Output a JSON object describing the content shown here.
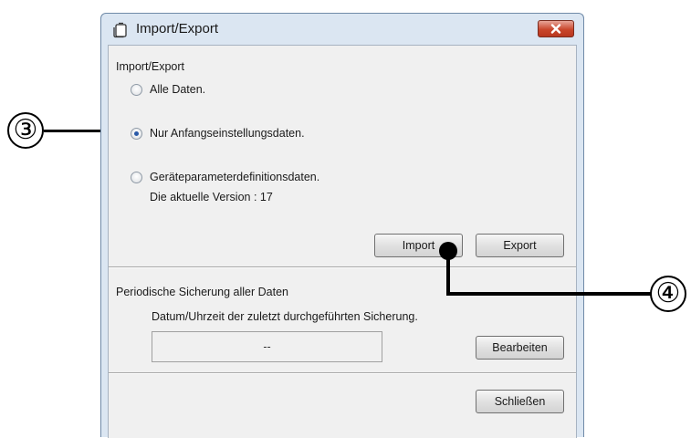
{
  "window": {
    "title": "Import/Export",
    "app_icon": "document-icon",
    "close_icon": "close-icon"
  },
  "import_export": {
    "heading": "Import/Export",
    "options": [
      {
        "label": "Alle Daten.",
        "checked": false
      },
      {
        "label": "Nur Anfangseinstellungsdaten.",
        "checked": true
      },
      {
        "label": "Geräteparameterdefinitionsdaten.",
        "checked": false
      }
    ],
    "version_text": "Die aktuelle Version : 17",
    "import_label": "Import",
    "export_label": "Export"
  },
  "backup": {
    "heading": "Periodische Sicherung aller Daten",
    "last_backup_label": "Datum/Uhrzeit der zuletzt durchgeführten Sicherung.",
    "last_backup_value": "--",
    "edit_label": "Bearbeiten"
  },
  "close_label": "Schließen",
  "callouts": {
    "step_3": "③",
    "step_4": "④"
  }
}
